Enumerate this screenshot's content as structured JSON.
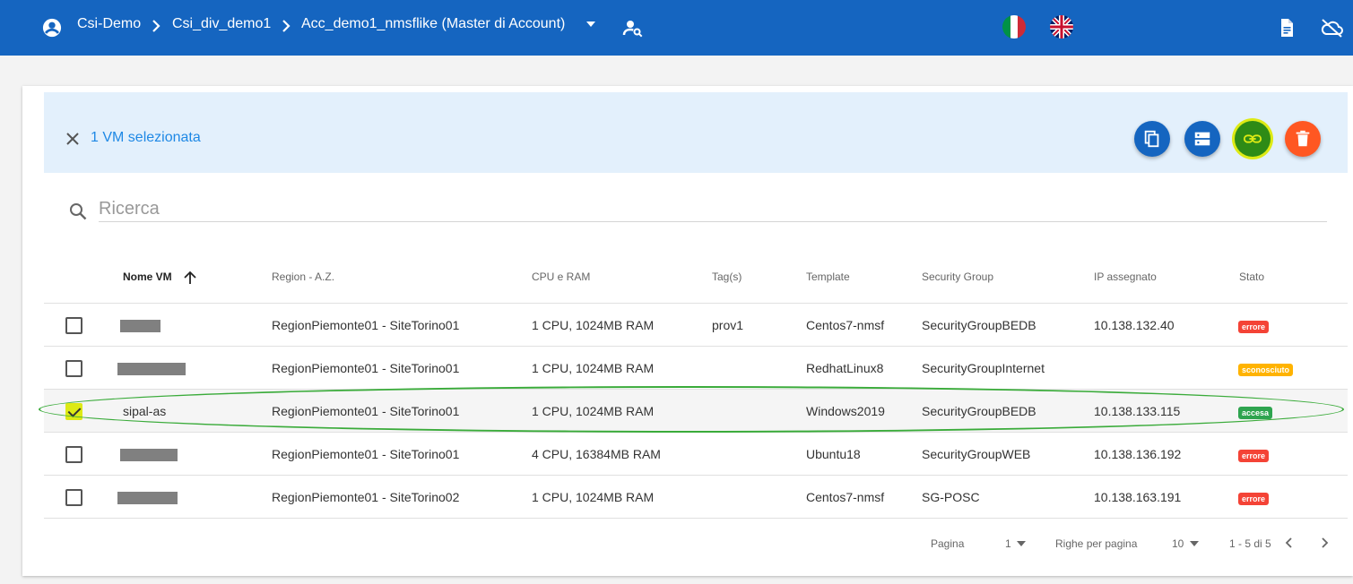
{
  "header": {
    "breadcrumbs": [
      "Csi-Demo",
      "Csi_div_demo1",
      "Acc_demo1_nmsflike (Master di Account)"
    ],
    "colors": {
      "bar": "#1565c0"
    },
    "flags": [
      "italian-flag",
      "uk-flag"
    ]
  },
  "selection": {
    "text": "1 VM selezionata",
    "actions": [
      {
        "name": "copy-button",
        "icon": "copy-icon",
        "color": "#1565c0"
      },
      {
        "name": "storage-button",
        "icon": "storage-icon",
        "color": "#1565c0"
      },
      {
        "name": "link-button",
        "icon": "link-icon",
        "color": "#2e8b16"
      },
      {
        "name": "delete-button",
        "icon": "trash-icon",
        "color": "#ff5722"
      }
    ]
  },
  "search": {
    "placeholder": "Ricerca",
    "value": ""
  },
  "table": {
    "columns": [
      "Nome VM",
      "Region - A.Z.",
      "CPU e RAM",
      "Tag(s)",
      "Template",
      "Security Group",
      "IP assegnato",
      "Stato"
    ],
    "sorted_column": "Nome VM",
    "sort_direction": "ascending",
    "rows": [
      {
        "checked": false,
        "name": "",
        "name_redacted": true,
        "region": "RegionPiemonte01 - SiteTorino01",
        "cpu": "1 CPU, 1024MB RAM",
        "tags": "prov1",
        "template": "Centos7-nmsf",
        "sg": "SecurityGroupBEDB",
        "ip": "10.138.132.40",
        "status": "errore",
        "status_color": "#f44336"
      },
      {
        "checked": false,
        "name": "",
        "name_redacted": true,
        "region": "RegionPiemonte01 - SiteTorino01",
        "cpu": "1 CPU, 1024MB RAM",
        "tags": "",
        "template": "RedhatLinux8",
        "sg": "SecurityGroupInternet",
        "ip": "",
        "status": "sconosciuto",
        "status_color": "#ffb300"
      },
      {
        "checked": true,
        "name": "sipal-as",
        "name_redacted": false,
        "region": "RegionPiemonte01 - SiteTorino01",
        "cpu": "1 CPU, 1024MB RAM",
        "tags": "",
        "template": "Windows2019",
        "sg": "SecurityGroupBEDB",
        "ip": "10.138.133.115",
        "status": "accesa",
        "status_color": "#2ea44f"
      },
      {
        "checked": false,
        "name": "",
        "name_redacted": true,
        "region": "RegionPiemonte01 - SiteTorino01",
        "cpu": "4 CPU, 16384MB RAM",
        "tags": "",
        "template": "Ubuntu18",
        "sg": "SecurityGroupWEB",
        "ip": "10.138.136.192",
        "status": "errore",
        "status_color": "#f44336"
      },
      {
        "checked": false,
        "name": "",
        "name_redacted": true,
        "region": "RegionPiemonte01 - SiteTorino02",
        "cpu": "1 CPU, 1024MB RAM",
        "tags": "",
        "template": "Centos7-nmsf",
        "sg": "SG-POSC",
        "ip": "10.138.163.191",
        "status": "errore",
        "status_color": "#f44336"
      }
    ]
  },
  "pagination": {
    "page_label": "Pagina",
    "page": "1",
    "rows_label": "Righe per pagina",
    "rows_per_page": "10",
    "range": "1 - 5 di 5"
  }
}
